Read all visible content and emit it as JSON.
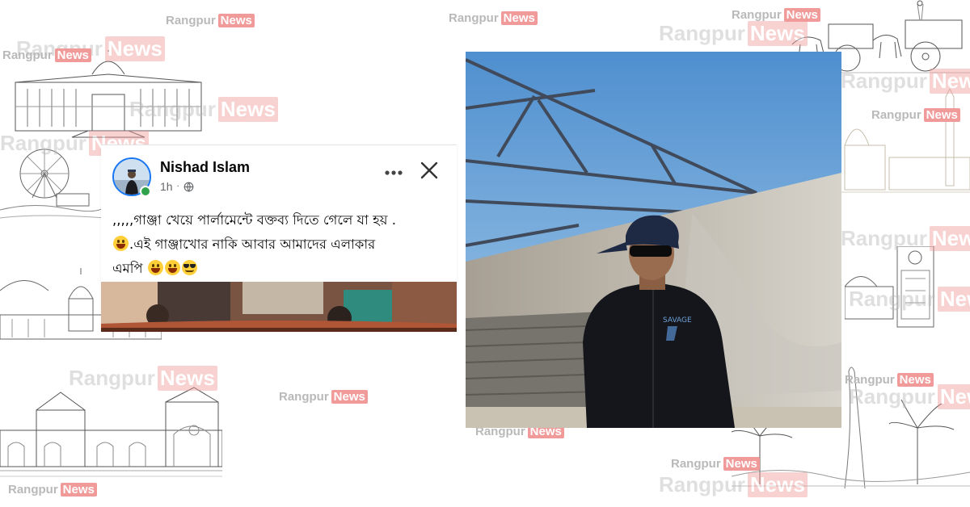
{
  "watermark": {
    "word": "Rangpur",
    "badge": "News"
  },
  "post": {
    "author": "Nishad Islam",
    "time": "1h",
    "line1": ",,,,,গাঞ্জা খেয়ে পার্লামেন্টে বক্তব্য দিতে গেলে যা হয় .",
    "line2": ".এই গাঞ্জাখোর নাকি আবার আমাদের এলাকার",
    "line3": "এমপি",
    "icons": {
      "avatar": "profile-photo",
      "more": "more-options-icon",
      "close": "close-icon",
      "privacy": "globe-icon"
    }
  },
  "photo": {
    "shirt_text": "SAVAGE"
  },
  "colors": {
    "facebook_blue": "#1877f2",
    "online_green": "#31a24c",
    "watermark_badge": "#f19a9a",
    "watermark_text": "#b9b9b9"
  }
}
